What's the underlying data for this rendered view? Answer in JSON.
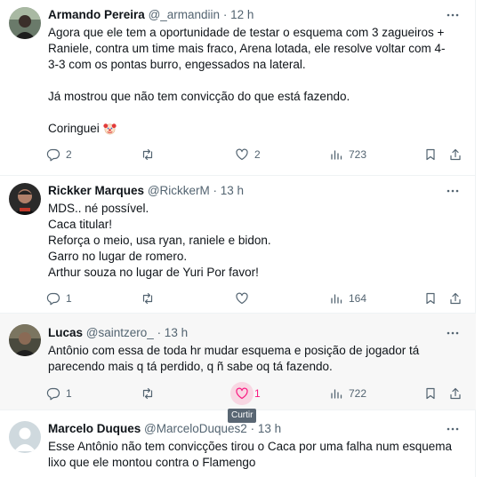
{
  "tweets": [
    {
      "name": "Armando Pereira",
      "handle": "@_armandiin",
      "time": "· 12 h",
      "lines": [
        "Agora que ele tem a oportunidade de testar o esquema com 3 zagueiros +",
        "Raniele, contra um time mais fraco, Arena lotada, ele resolve voltar com 4-",
        "3-3 com os pontas burro, engessados na lateral.",
        "",
        "Já mostrou que não tem convicção do que está fazendo.",
        "",
        "Coringuei"
      ],
      "emoji": "clown-face-icon",
      "replies": "2",
      "retweets": "",
      "likes": "2",
      "views": "723"
    },
    {
      "name": "Rickker Marques",
      "handle": "@RickkerM",
      "time": "· 13 h",
      "lines": [
        "MDS.. né possível.",
        "Caca titular!",
        "Reforça o meio, usa ryan, raniele e bidon.",
        "Garro no lugar de romero.",
        "Arthur souza no lugar de Yuri Por favor!"
      ],
      "replies": "1",
      "retweets": "",
      "likes": "",
      "views": "164"
    },
    {
      "name": "Lucas",
      "handle": "@saintzero_",
      "time": "· 13 h",
      "lines": [
        "Antônio com essa de toda hr mudar esquema e posição de jogador tá",
        "parecendo mais q tá perdido, q ñ sabe oq tá fazendo."
      ],
      "replies": "1",
      "retweets": "",
      "likes": "1",
      "views": "722"
    },
    {
      "name": "Marcelo Duques",
      "handle": "@MarceloDuques2",
      "time": "· 13 h",
      "lines": [
        "Esse Antônio não tem convicções tirou o Caca por uma falha num esquema",
        "lixo que ele montou contra o Flamengo"
      ]
    }
  ],
  "tooltip": "Curtir",
  "colors": {
    "text": "#0f1419",
    "muted": "#536471",
    "like": "#f91880",
    "border": "#eff3f4"
  }
}
